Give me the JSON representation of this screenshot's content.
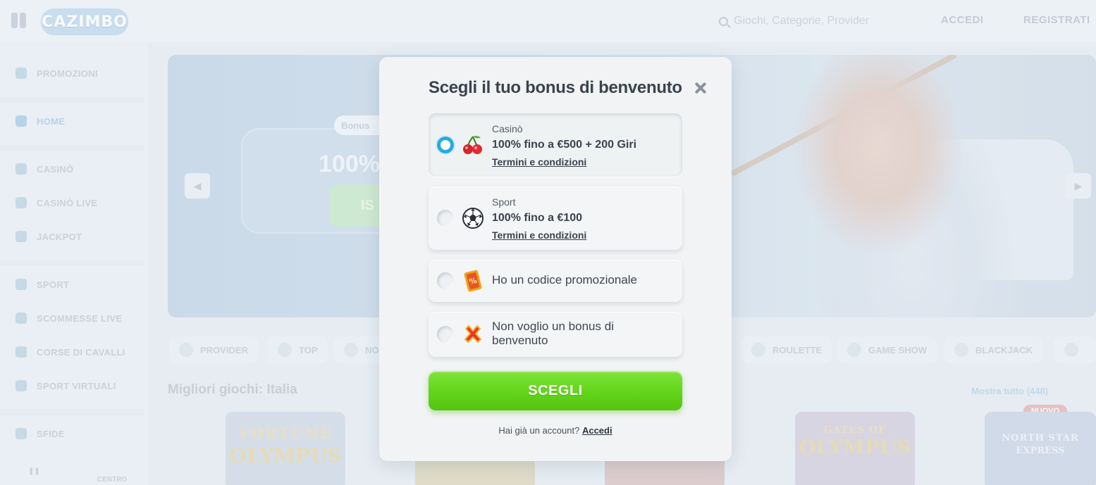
{
  "header": {
    "logo_text": "CAZIMBO",
    "search_placeholder": "Giochi, Categorie, Provider",
    "login_label": "ACCEDI",
    "register_label": "REGISTRATI"
  },
  "sidebar": {
    "items": [
      {
        "label": "PROMOZIONI"
      },
      {
        "label": "HOME"
      },
      {
        "label": "CASINÒ"
      },
      {
        "label": "CASINÒ LIVE"
      },
      {
        "label": "JACKPOT"
      },
      {
        "label": "SPORT"
      },
      {
        "label": "SCOMMESSE LIVE"
      },
      {
        "label": "CORSE DI CAVALLI"
      },
      {
        "label": "SPORT VIRTUALI"
      },
      {
        "label": "SFIDE"
      }
    ],
    "bottom_label": "CENTRO"
  },
  "banner": {
    "pill_text": "Bonus",
    "headline": "100%",
    "button_text": "IS"
  },
  "categories": [
    {
      "label": "PROVIDER"
    },
    {
      "label": "TOP"
    },
    {
      "label": "NO"
    },
    {
      "label": "ROULETTE"
    },
    {
      "label": "GAME SHOW"
    },
    {
      "label": "BLACKJACK"
    }
  ],
  "games_section": {
    "title": "Migliori giochi: Italia",
    "see_all": "Mostra tutto (448)",
    "new_badge": "NUOVO",
    "tiles": [
      {
        "line1": "FORTUNE",
        "line2": "OLYMPUS"
      },
      {
        "line1": "",
        "line2": ""
      },
      {
        "line1": "",
        "line2": ""
      },
      {
        "line1": "GATES OF",
        "line2": "OLYMPUS"
      },
      {
        "line1": "NORTH STAR",
        "line2": "EXPRESS"
      }
    ]
  },
  "modal": {
    "title": "Scegli il tuo bonus di benvenuto",
    "options": [
      {
        "category": "Casinò",
        "offer": "100% fino a €500 + 200 Giri",
        "terms": "Termini e condizioni",
        "icon": "cherry-icon",
        "selected": true
      },
      {
        "category": "Sport",
        "offer": "100% fino a €100",
        "terms": "Termini e condizioni",
        "icon": "football-icon",
        "selected": false
      },
      {
        "text": "Ho un codice promozionale",
        "icon": "promo-code-icon",
        "selected": false
      },
      {
        "text": "Non voglio un bonus di benvenuto",
        "icon": "red-x-icon",
        "selected": false
      }
    ],
    "choose_button": "SCEGLI",
    "footer_text": "Hai già un account?",
    "footer_link": "Accedi"
  },
  "colors": {
    "accent_blue": "#29a9e6",
    "button_green": "#62d41a",
    "modal_bg": "#f1f3f4",
    "title_text": "#3b4350"
  }
}
